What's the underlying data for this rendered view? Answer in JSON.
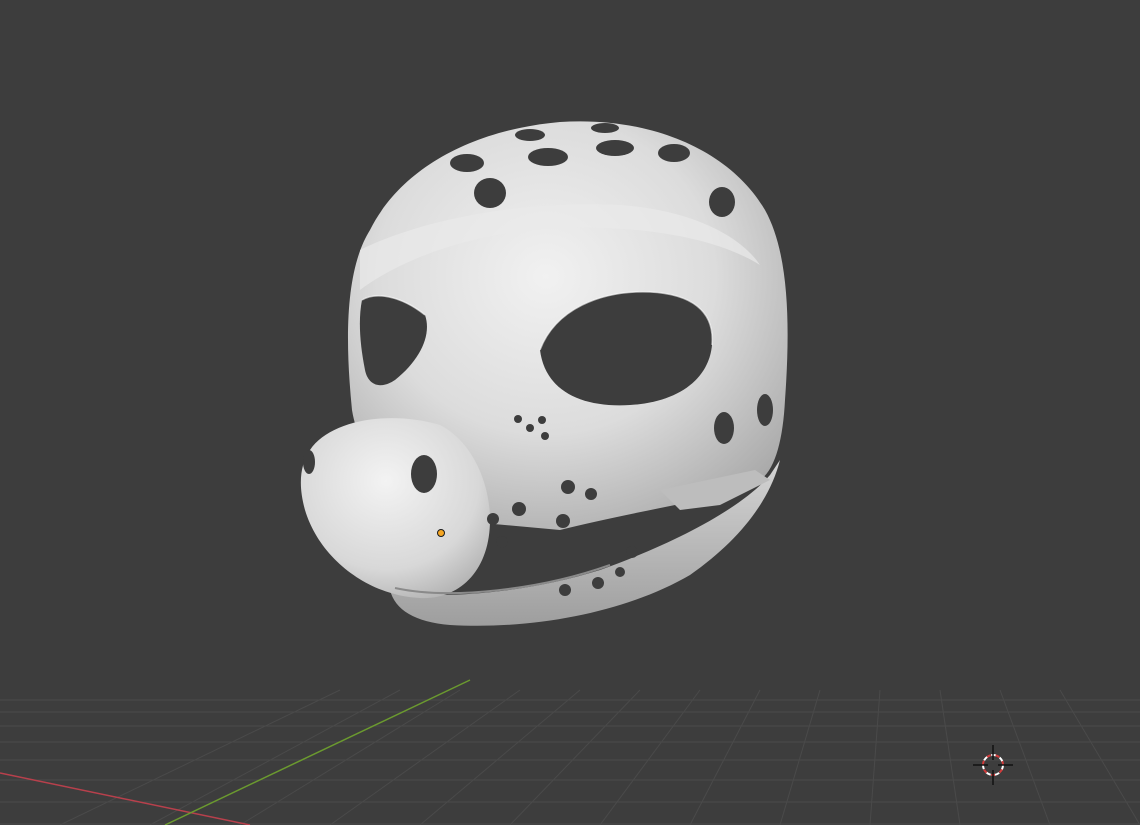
{
  "viewport": {
    "background_color": "#3d3d3d",
    "grid_color": "#4a4a4a",
    "x_axis_color": "#b8404c",
    "y_axis_color": "#6b9a2f"
  },
  "scene": {
    "object": "mask-mesh",
    "origin_marker_color": "#f5a623",
    "cursor_icon": "3d-cursor-icon"
  }
}
